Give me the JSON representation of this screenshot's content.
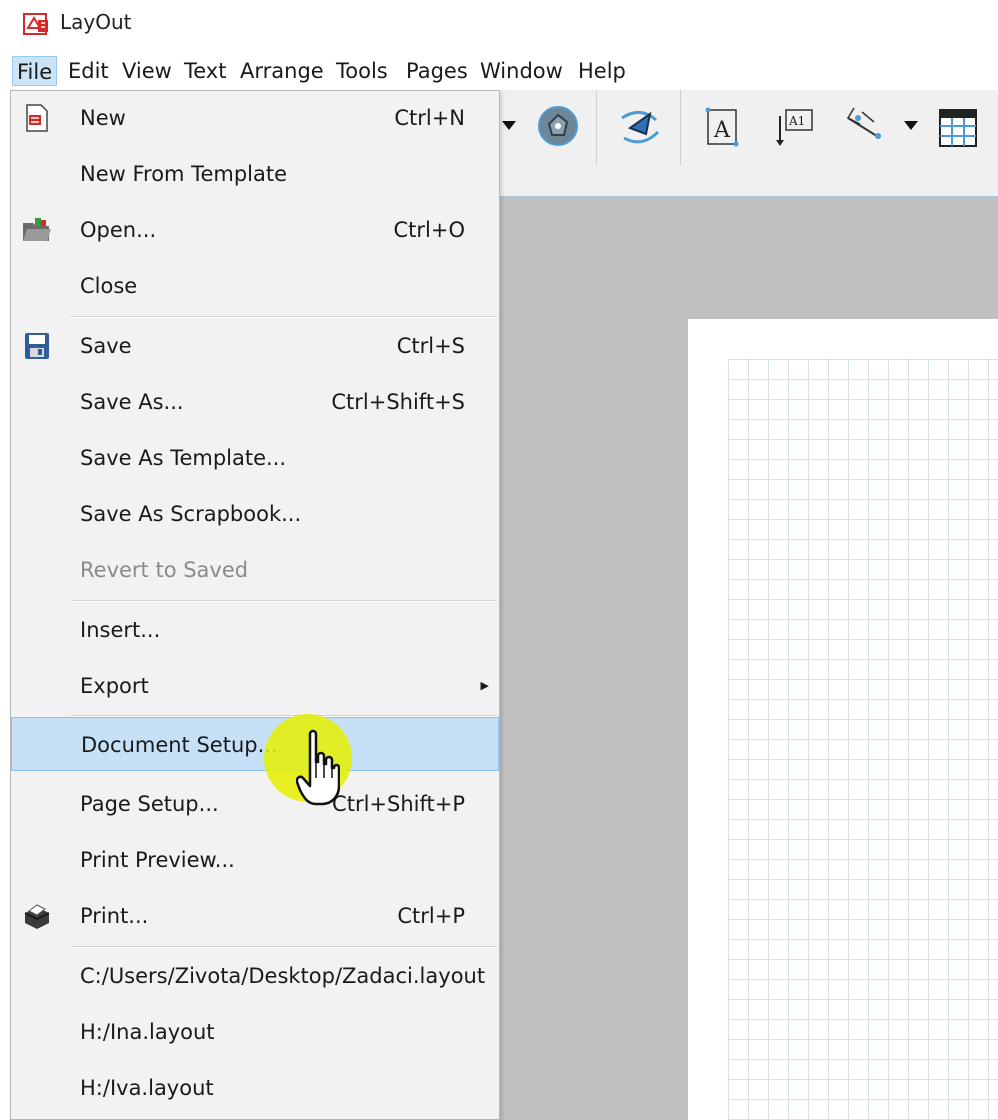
{
  "window": {
    "title": "LayOut"
  },
  "menubar": {
    "items": [
      {
        "label": "File",
        "active": true
      },
      {
        "label": "Edit"
      },
      {
        "label": "View"
      },
      {
        "label": "Text"
      },
      {
        "label": "Arrange"
      },
      {
        "label": "Tools"
      },
      {
        "label": "Pages"
      },
      {
        "label": "Window"
      },
      {
        "label": "Help"
      }
    ]
  },
  "file_menu": {
    "items": [
      {
        "label": "New",
        "shortcut": "Ctrl+N",
        "icon": "new-document-icon"
      },
      {
        "label": "New From Template",
        "shortcut": ""
      },
      {
        "label": "Open...",
        "shortcut": "Ctrl+O",
        "icon": "open-folder-icon"
      },
      {
        "label": "Close",
        "shortcut": ""
      },
      {
        "label": "Save",
        "shortcut": "Ctrl+S",
        "icon": "floppy-disk-icon"
      },
      {
        "label": "Save As...",
        "shortcut": "Ctrl+Shift+S"
      },
      {
        "label": "Save As Template...",
        "shortcut": ""
      },
      {
        "label": "Save As Scrapbook...",
        "shortcut": ""
      },
      {
        "label": "Revert to Saved",
        "shortcut": "",
        "disabled": true
      },
      {
        "label": "Insert...",
        "shortcut": ""
      },
      {
        "label": "Export",
        "shortcut": "",
        "submenu": true
      },
      {
        "label": "Document Setup...",
        "shortcut": "",
        "highlighted": true
      },
      {
        "label": "Page Setup...",
        "shortcut": "Ctrl+Shift+P"
      },
      {
        "label": "Print Preview...",
        "shortcut": ""
      },
      {
        "label": "Print...",
        "shortcut": "Ctrl+P",
        "icon": "printer-icon"
      },
      {
        "label": "C:/Users/Zivota/Desktop/Zadaci.layout",
        "shortcut": ""
      },
      {
        "label": "H:/Ina.layout",
        "shortcut": ""
      },
      {
        "label": "H:/Iva.layout",
        "shortcut": ""
      }
    ]
  },
  "toolbar": {
    "icons": [
      "dropdown-arrow-icon",
      "offset-tool-icon",
      "style-tool-icon",
      "text-tool-icon",
      "label-tool-icon",
      "dimension-tool-icon",
      "dropdown-arrow-icon",
      "table-tool-icon"
    ]
  },
  "colors": {
    "menu_highlight": "#c6e0f8",
    "cursor_glow": "#e6f000",
    "canvas_bg": "#c0c0c0",
    "grid_line": "#d3e4e8"
  }
}
